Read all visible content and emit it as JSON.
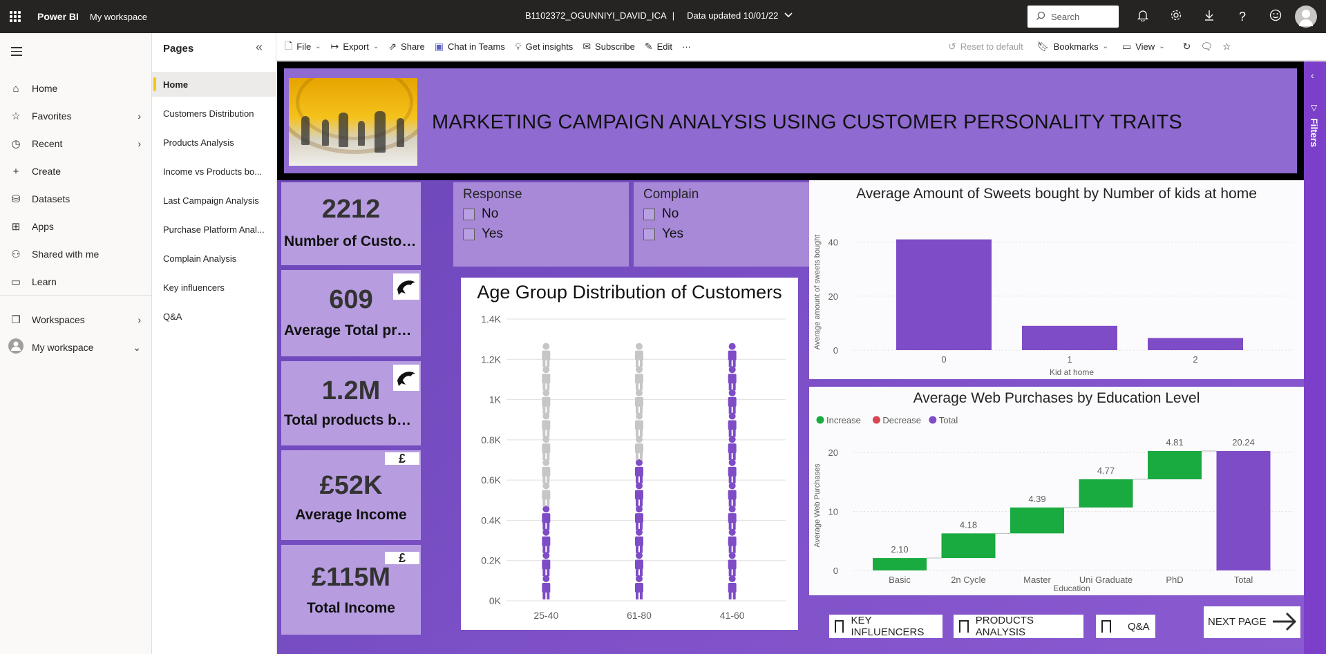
{
  "topbar": {
    "app_name": "Power BI",
    "workspace": "My workspace",
    "report_name": "B1102372_OGUNNIYI_DAVID_ICA",
    "separator": "|",
    "data_updated": "Data updated 10/01/22",
    "search_placeholder": "Search",
    "icons": [
      "bell-icon",
      "gear-icon",
      "download-icon",
      "help-icon",
      "smiley-icon",
      "avatar"
    ]
  },
  "leftnav": {
    "items": [
      {
        "label": "Home",
        "icon": "home-icon"
      },
      {
        "label": "Favorites",
        "icon": "star-icon"
      },
      {
        "label": "Recent",
        "icon": "clock-icon"
      },
      {
        "label": "Create",
        "icon": "plus-icon"
      },
      {
        "label": "Datasets",
        "icon": "database-icon"
      },
      {
        "label": "Apps",
        "icon": "apps-icon"
      },
      {
        "label": "Shared with me",
        "icon": "share-person-icon"
      },
      {
        "label": "Learn",
        "icon": "book-icon"
      },
      {
        "label": "Workspaces",
        "icon": "workspaces-icon"
      },
      {
        "label": "My workspace",
        "icon": "avatar-icon"
      }
    ]
  },
  "pages": {
    "title": "Pages",
    "items": [
      "Home",
      "Customers Distribution",
      "Products Analysis",
      "Income vs Products bo...",
      "Last Campaign Analysis",
      "Purchase Platform Anal...",
      "Complain Analysis",
      "Key influencers",
      "Q&A"
    ]
  },
  "actionbar": {
    "file": "File",
    "export": "Export",
    "share": "Share",
    "chat": "Chat in Teams",
    "insights": "Get insights",
    "subscribe": "Subscribe",
    "edit": "Edit",
    "more": "···",
    "reset": "Reset to default",
    "bookmarks": "Bookmarks",
    "view": "View"
  },
  "report": {
    "banner_title": "MARKETING CAMPAIGN ANALYSIS USING CUSTOMER PERSONALITY TRAITS",
    "cards": [
      {
        "value": "2212",
        "label": "Number of Customers"
      },
      {
        "value": "609",
        "label": "Average Total produc..."
      },
      {
        "value": "1.2M",
        "label": "Total products bought"
      },
      {
        "value": "£52K",
        "label": "Average Income"
      },
      {
        "value": "£115M",
        "label": "Total Income"
      }
    ],
    "slicers": [
      {
        "title": "Response",
        "options": [
          "No",
          "Yes"
        ]
      },
      {
        "title": "Complain",
        "options": [
          "No",
          "Yes"
        ]
      }
    ],
    "nav_buttons": [
      "KEY INFLUENCERS",
      "PRODUCTS ANALYSIS",
      "Q&A"
    ],
    "next_page": "NEXT PAGE",
    "filters_label": "Filters",
    "colors": {
      "accent": "#7e4cc6",
      "green": "#1aab40",
      "red": "#d64550",
      "grey": "#c8c6c4"
    }
  },
  "chart_data": [
    {
      "type": "pictograph",
      "title": "Age Group Distribution of Customers",
      "categories": [
        "25-40",
        "61-80",
        "41-60"
      ],
      "values": [
        450,
        700,
        1200
      ],
      "y_ticks": [
        "0K",
        "0.2K",
        "0.4K",
        "0.6K",
        "0.8K",
        "1K",
        "1.2K",
        "1.4K"
      ],
      "ylim": [
        0,
        1400
      ]
    },
    {
      "type": "bar",
      "title": "Average Amount of Sweets bought by Number of kids at home",
      "categories": [
        "0",
        "1",
        "2"
      ],
      "values": [
        41,
        9,
        4.5
      ],
      "xlabel": "Kid at home",
      "ylabel": "Average amount of sweets bought",
      "y_ticks": [
        "0",
        "20",
        "40"
      ],
      "ylim": [
        0,
        45
      ]
    },
    {
      "type": "waterfall",
      "title": "Average Web Purchases by Education Level",
      "legend": [
        "Increase",
        "Decrease",
        "Total"
      ],
      "categories": [
        "Basic",
        "2n Cycle",
        "Master",
        "Uni Graduate",
        "PhD",
        "Total"
      ],
      "values": [
        2.1,
        4.18,
        4.39,
        4.77,
        4.81,
        20.24
      ],
      "labels": [
        "2.10",
        "4.18",
        "4.39",
        "4.77",
        "4.81",
        "20.24"
      ],
      "xlabel": "Education",
      "ylabel": "Average Web Purchases",
      "y_ticks": [
        "0",
        "10",
        "20"
      ],
      "ylim": [
        0,
        22
      ]
    }
  ]
}
